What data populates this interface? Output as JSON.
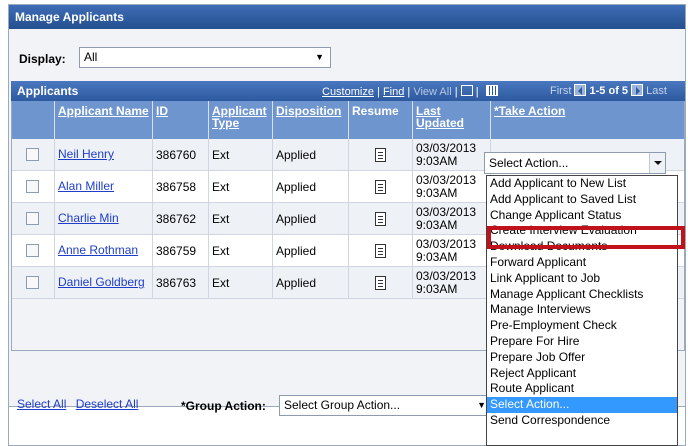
{
  "page": {
    "title": "Manage Applicants"
  },
  "display": {
    "label": "Display:",
    "value": "All"
  },
  "grid": {
    "title": "Applicants",
    "customize": "Customize",
    "find": "Find",
    "view_all": "View All",
    "separator": "|",
    "first": "First",
    "count": "1-5 of 5",
    "last": "Last",
    "columns": [
      "Applicant Name",
      "ID",
      "Applicant Type",
      "Disposition",
      "Resume",
      "Last Updated",
      "*Take Action"
    ],
    "rows": [
      {
        "name": "Neil Henry",
        "id": "386760",
        "type": "Ext",
        "disposition": "Applied",
        "date": "03/03/2013",
        "time": "9:03AM"
      },
      {
        "name": "Alan Miller",
        "id": "386758",
        "type": "Ext",
        "disposition": "Applied",
        "date": "03/03/2013",
        "time": "9:03AM"
      },
      {
        "name": "Charlie Min",
        "id": "386762",
        "type": "Ext",
        "disposition": "Applied",
        "date": "03/03/2013",
        "time": "9:03AM"
      },
      {
        "name": "Anne Rothman",
        "id": "386759",
        "type": "Ext",
        "disposition": "Applied",
        "date": "03/03/2013",
        "time": "9:03AM"
      },
      {
        "name": "Daniel Goldberg",
        "id": "386763",
        "type": "Ext",
        "disposition": "Applied",
        "date": "03/03/2013",
        "time": "9:03AM"
      }
    ]
  },
  "take_action": {
    "selected": "Select Action...",
    "options": [
      "Add Applicant to New List",
      "Add Applicant to Saved List",
      "Change Applicant Status",
      "Create Interview Evaluation",
      "Download Documents",
      "Forward Applicant",
      "Link Applicant to Job",
      "Manage Applicant Checklists",
      "Manage Interviews",
      "Pre-Employment Check",
      "Prepare For Hire",
      "Prepare Job Offer",
      "Reject Applicant",
      "Route Applicant",
      "Select Action...",
      "Send Correspondence"
    ],
    "highlight_color": "#c0121b"
  },
  "bottom": {
    "select_all": "Select All",
    "deselect_all": "Deselect All",
    "group_action_label": "*Group Action:",
    "group_action_value": "Select Group Action..."
  },
  "colors": {
    "header": "#2f5aa0",
    "column_header": "#6f95cf",
    "link": "#1f3ec7",
    "selected_option": "#3399ff"
  }
}
